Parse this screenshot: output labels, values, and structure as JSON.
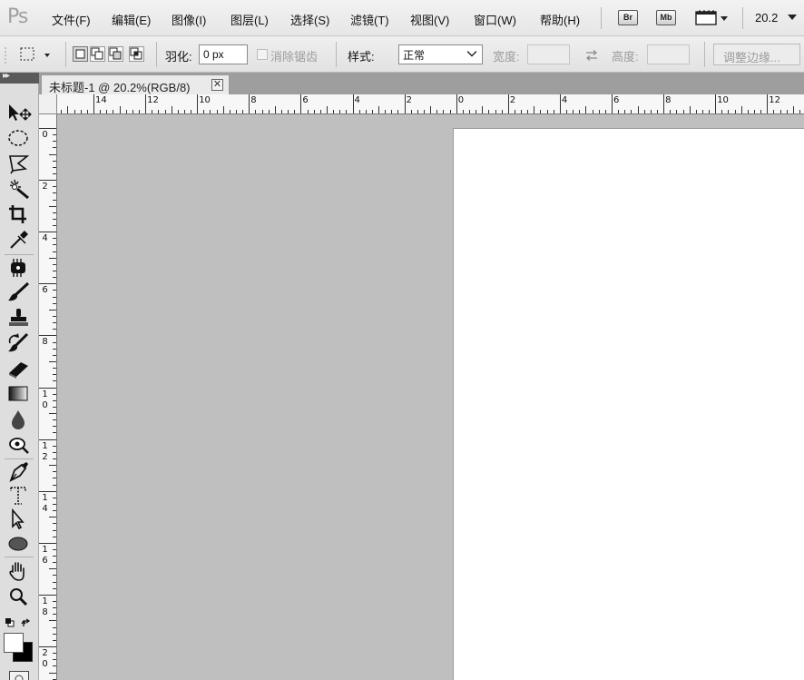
{
  "app": {
    "logo": "Ps"
  },
  "menu": [
    {
      "id": "file",
      "label": "文件(F)"
    },
    {
      "id": "edit",
      "label": "编辑(E)"
    },
    {
      "id": "image",
      "label": "图像(I)"
    },
    {
      "id": "layer",
      "label": "图层(L)"
    },
    {
      "id": "select",
      "label": "选择(S)"
    },
    {
      "id": "filter",
      "label": "滤镜(T)"
    },
    {
      "id": "view",
      "label": "视图(V)"
    },
    {
      "id": "window",
      "label": "窗口(W)"
    },
    {
      "id": "help",
      "label": "帮助(H)"
    }
  ],
  "app_buttons": {
    "bridge": "Br",
    "mini_bridge": "Mb"
  },
  "zoom_level": "20.2",
  "options": {
    "feather_label": "羽化:",
    "feather_value": "0 px",
    "antialias_label": "消除锯齿",
    "style_label": "样式:",
    "style_value": "正常",
    "width_label": "宽度:",
    "height_label": "高度:",
    "refine_edge_button": "调整边缘..."
  },
  "document": {
    "tab_title": "未标题-1 @ 20.2%(RGB/8)",
    "close_glyph": "✕"
  },
  "rulers": {
    "top_labels": [
      "14",
      "12",
      "10",
      "8",
      "6",
      "4",
      "2",
      "0",
      "2",
      "4",
      "6",
      "8",
      "10",
      "12"
    ],
    "left_labels": [
      "0",
      "2",
      "4",
      "6",
      "8",
      "10",
      "12",
      "14",
      "16",
      "18",
      "20"
    ]
  },
  "tools": [
    {
      "icon": "move-icon"
    },
    {
      "icon": "elliptical-marquee-icon"
    },
    {
      "icon": "polygonal-lasso-icon"
    },
    {
      "icon": "magic-wand-icon"
    },
    {
      "icon": "crop-icon"
    },
    {
      "icon": "eyedropper-icon"
    },
    {
      "icon": "spot-healing-brush-icon"
    },
    {
      "icon": "brush-icon"
    },
    {
      "icon": "clone-stamp-icon"
    },
    {
      "icon": "history-brush-icon"
    },
    {
      "icon": "eraser-icon"
    },
    {
      "icon": "gradient-icon"
    },
    {
      "icon": "blur-icon"
    },
    {
      "icon": "dodge-icon"
    },
    {
      "icon": "pen-icon"
    },
    {
      "icon": "vertical-type-mask-icon"
    },
    {
      "icon": "path-selection-icon"
    },
    {
      "icon": "ellipse-shape-icon"
    },
    {
      "icon": "hand-icon"
    },
    {
      "icon": "zoom-icon"
    }
  ],
  "colors": {
    "menubar_bg": "#ececec",
    "pasteboard": "#bfbfbf",
    "canvas": "#ffffff",
    "foreground": "#000000",
    "background": "#ffffff"
  }
}
